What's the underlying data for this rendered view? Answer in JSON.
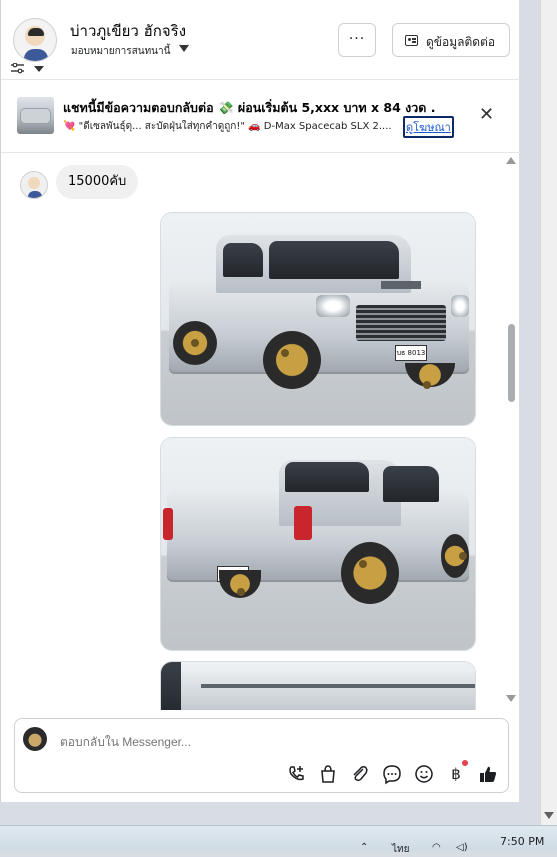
{
  "header": {
    "name": "บ่าวภูเขียว ฮักจริง",
    "assign_label": "มอบหมายการสนทนานี้",
    "more_label": "···",
    "contact_button_label": "ดูข้อมูลติดต่อ"
  },
  "ad_banner": {
    "title": "แชทนี้มีข้อความตอบกลับต่อ 💸 ผ่อนเริ่มต้น 5,xxx บาท x 84 งวด .",
    "subtitle": "💘 \"ดีเซลพันธุ์ดุ... สะบัดฝุ่นใส่ทุกคำดูถูก!\" 🚗 D-Max Spacecab SLX 2....",
    "link_label": "ดูโฆษณา",
    "close_label": "✕"
  },
  "chat": {
    "messages": [
      {
        "type": "text",
        "text": "15000คับ"
      },
      {
        "type": "image",
        "plate": "บธ 8013"
      },
      {
        "type": "image",
        "plate": "บธ 8013"
      },
      {
        "type": "image"
      }
    ]
  },
  "composer": {
    "placeholder": "ตอบกลับใน Messenger...",
    "tools": [
      "phone-plus-icon",
      "shopping-bag-icon",
      "paperclip-icon",
      "chat-bubble-icon",
      "emoji-icon",
      "baht-icon",
      "thumbs-up-icon"
    ]
  },
  "taskbar": {
    "time": "7:50 PM",
    "language": "ไทย"
  },
  "colors": {
    "link": "#1c5ad3",
    "text": "#050505",
    "muted": "#65676b",
    "notification": "#e4414f"
  }
}
